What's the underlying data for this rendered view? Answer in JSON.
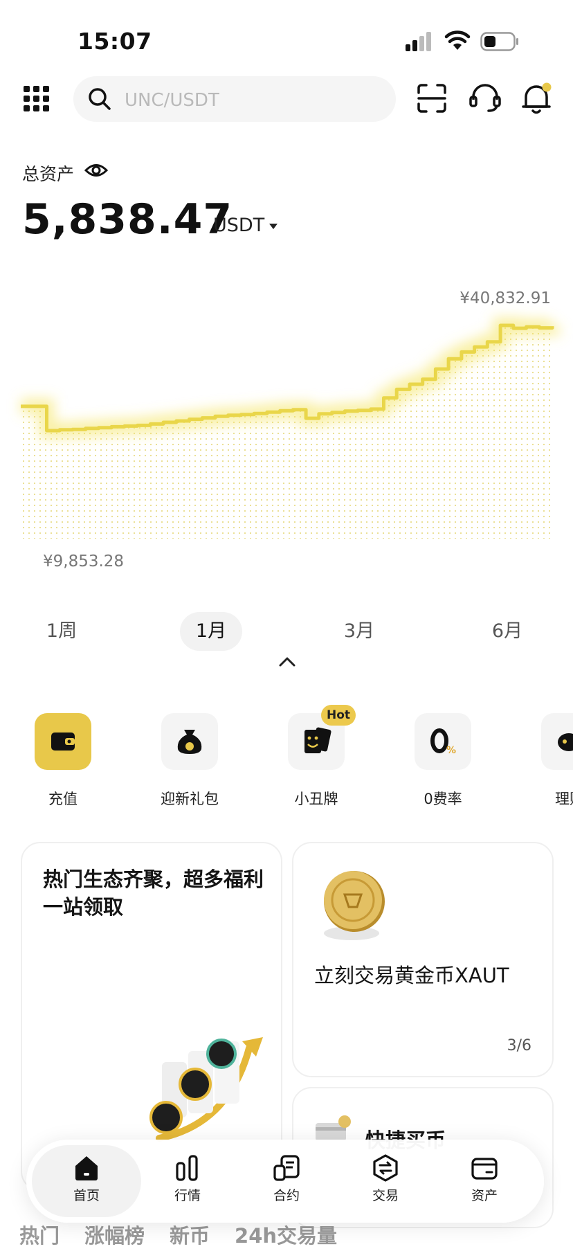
{
  "status_bar": {
    "time": "15:07"
  },
  "search": {
    "placeholder": "UNC/USDT"
  },
  "balance": {
    "label": "总资产",
    "amount": "5,838.47",
    "unit": "USDT"
  },
  "chart_data": {
    "type": "area",
    "max_label": "¥40,832.91",
    "min_label": "¥9,853.28",
    "y_min": 9853.28,
    "y_max": 40832.91,
    "values": [
      17000,
      17000,
      9853.28,
      10100,
      10200,
      10500,
      10700,
      11000,
      11200,
      11400,
      11800,
      12300,
      12700,
      13200,
      13600,
      14100,
      14400,
      14600,
      14900,
      15300,
      15700,
      16000,
      13500,
      14800,
      15200,
      15600,
      15800,
      16200,
      19500,
      22000,
      23500,
      25000,
      28000,
      31000,
      33000,
      34500,
      36000,
      40832.91,
      40000,
      40400,
      40100,
      40600
    ]
  },
  "ranges": [
    {
      "label": "1周"
    },
    {
      "label": "1月",
      "active": true
    },
    {
      "label": "3月"
    },
    {
      "label": "6月"
    }
  ],
  "shortcuts": [
    {
      "label": "充值",
      "icon": "wallet-icon"
    },
    {
      "label": "迎新礼包",
      "icon": "money-bag-icon"
    },
    {
      "label": "小丑牌",
      "icon": "joker-card-icon",
      "badge": "Hot"
    },
    {
      "label": "0费率",
      "icon": "zero-fee-icon"
    },
    {
      "label": "理财",
      "icon": "piggy-bank-icon"
    }
  ],
  "cards": {
    "promo": {
      "title": "热门生态齐聚，超多福利一站领取"
    },
    "gold": {
      "title": "立刻交易黄金币XAUT",
      "page": "3/6"
    },
    "quick_buy": {
      "title": "快捷买币"
    }
  },
  "market_tabs": [
    "热门",
    "涨幅榜",
    "新币",
    "24h交易量"
  ],
  "nav": [
    {
      "label": "首页",
      "icon": "home-icon",
      "active": true
    },
    {
      "label": "行情",
      "icon": "market-icon"
    },
    {
      "label": "合约",
      "icon": "contract-icon"
    },
    {
      "label": "交易",
      "icon": "trade-icon"
    },
    {
      "label": "资产",
      "icon": "assets-wallet-icon"
    }
  ],
  "colors": {
    "accent": "#ecc94d",
    "chart_line": "#e9d64a"
  }
}
